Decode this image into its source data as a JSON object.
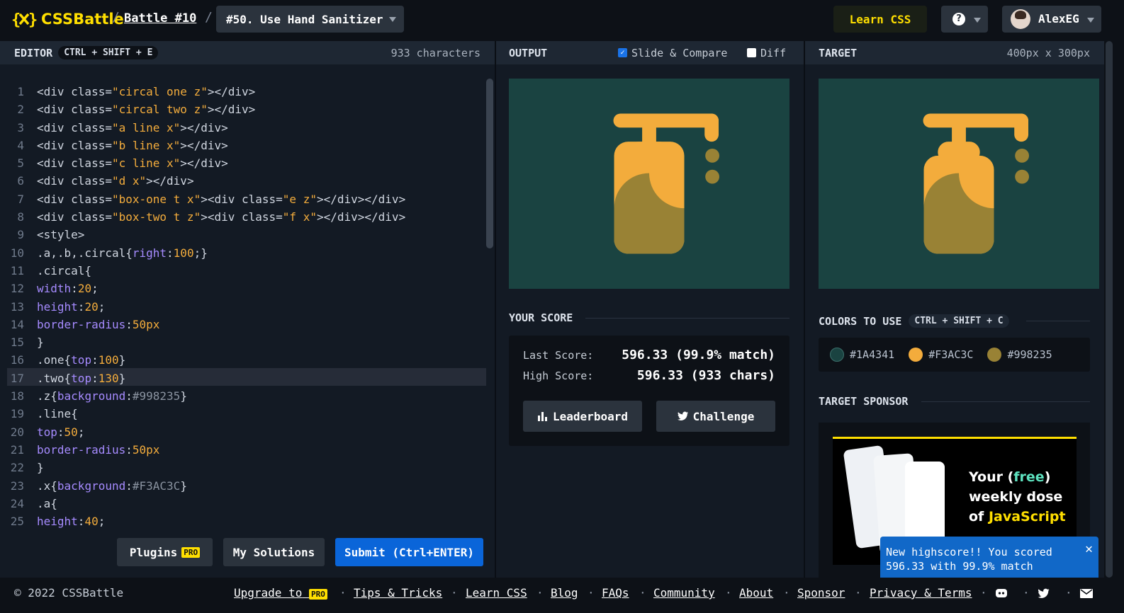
{
  "header": {
    "logo": "CSSBattle",
    "battle": "Battle #10",
    "challenge": "#50. Use Hand Sanitizer",
    "learn": "Learn CSS",
    "user": "AlexEG"
  },
  "editor": {
    "title": "EDITOR",
    "shortcut": "CTRL + SHIFT + E",
    "chars": "933 characters",
    "lines": [
      [
        [
          "t",
          "<div class="
        ],
        [
          "s",
          "\"circal one z\""
        ],
        [
          "t",
          "></div>"
        ]
      ],
      [
        [
          "t",
          "<div class="
        ],
        [
          "s",
          "\"circal two z\""
        ],
        [
          "t",
          "></div>"
        ]
      ],
      [
        [
          "t",
          "<div class="
        ],
        [
          "s",
          "\"a line x\""
        ],
        [
          "t",
          "></div>"
        ]
      ],
      [
        [
          "t",
          "<div class="
        ],
        [
          "s",
          "\"b line x\""
        ],
        [
          "t",
          "></div>"
        ]
      ],
      [
        [
          "t",
          "<div class="
        ],
        [
          "s",
          "\"c line x\""
        ],
        [
          "t",
          "></div>"
        ]
      ],
      [
        [
          "t",
          "<div class="
        ],
        [
          "s",
          "\"d x\""
        ],
        [
          "t",
          "></div>"
        ]
      ],
      [
        [
          "t",
          "<div class="
        ],
        [
          "s",
          "\"box-one t x\""
        ],
        [
          "t",
          "><div class="
        ],
        [
          "s",
          "\"e z\""
        ],
        [
          "t",
          "></div></div>"
        ]
      ],
      [
        [
          "t",
          "<div class="
        ],
        [
          "s",
          "\"box-two t z\""
        ],
        [
          "t",
          "><div class="
        ],
        [
          "s",
          "\"f x\""
        ],
        [
          "t",
          "></div></div>"
        ]
      ],
      [
        [
          "t",
          "<style>"
        ]
      ],
      [
        [
          "t",
          ".a,.b,.circal{"
        ],
        [
          "p",
          "right"
        ],
        [
          "t",
          ":"
        ],
        [
          "n",
          "100"
        ],
        [
          "t",
          ";}"
        ]
      ],
      [
        [
          "t",
          ".circal{"
        ]
      ],
      [
        [
          "p",
          "width"
        ],
        [
          "t",
          ":"
        ],
        [
          "n",
          "20"
        ],
        [
          "t",
          ";"
        ]
      ],
      [
        [
          "p",
          "height"
        ],
        [
          "t",
          ":"
        ],
        [
          "n",
          "20"
        ],
        [
          "t",
          ";"
        ]
      ],
      [
        [
          "p",
          "border-radius"
        ],
        [
          "t",
          ":"
        ],
        [
          "n",
          "50px"
        ]
      ],
      [
        [
          "t",
          "}"
        ]
      ],
      [
        [
          "t",
          ".one{"
        ],
        [
          "p",
          "top"
        ],
        [
          "t",
          ":"
        ],
        [
          "n",
          "100"
        ],
        [
          "t",
          "}"
        ]
      ],
      [
        [
          "t",
          ".two{"
        ],
        [
          "p",
          "top"
        ],
        [
          "t",
          ":"
        ],
        [
          "n",
          "130"
        ],
        [
          "t",
          "}"
        ]
      ],
      [
        [
          "t",
          ".z{"
        ],
        [
          "p",
          "background"
        ],
        [
          "t",
          ":"
        ],
        [
          "c",
          "#998235"
        ],
        [
          "t",
          "}"
        ]
      ],
      [
        [
          "t",
          ".line{"
        ]
      ],
      [
        [
          "p",
          "top"
        ],
        [
          "t",
          ":"
        ],
        [
          "n",
          "50"
        ],
        [
          "t",
          ";"
        ]
      ],
      [
        [
          "p",
          "border-radius"
        ],
        [
          "t",
          ":"
        ],
        [
          "n",
          "50px"
        ]
      ],
      [
        [
          "t",
          "}"
        ]
      ],
      [
        [
          "t",
          ".x{"
        ],
        [
          "p",
          "background"
        ],
        [
          "t",
          ":"
        ],
        [
          "c",
          "#F3AC3C"
        ],
        [
          "t",
          "}"
        ]
      ],
      [
        [
          "t",
          ".a{"
        ]
      ],
      [
        [
          "p",
          "height"
        ],
        [
          "t",
          ":"
        ],
        [
          "n",
          "40"
        ],
        [
          "t",
          ";"
        ]
      ]
    ],
    "line_numbers": [
      "1",
      "2",
      "3",
      "4",
      "5",
      "6",
      "7",
      "8",
      "9",
      "10",
      "11",
      "12",
      "13",
      "14",
      "15",
      "16",
      "17",
      "18",
      "19",
      "20",
      "21",
      "22",
      "23",
      "24",
      "25"
    ],
    "buttons": {
      "plugins": "Plugins",
      "pro": "PRO",
      "solutions": "My Solutions",
      "submit": "Submit (Ctrl+ENTER)"
    }
  },
  "output": {
    "title": "OUTPUT",
    "slide": "Slide & Compare",
    "diff": "Diff"
  },
  "target": {
    "title": "TARGET",
    "size": "400px x 300px"
  },
  "score": {
    "title": "YOUR SCORE",
    "last_label": "Last Score:",
    "last_value": "596.33 (99.9% match)",
    "high_label": "High Score:",
    "high_value": "596.33 (933 chars)",
    "leaderboard": "Leaderboard",
    "challenge": "Challenge"
  },
  "colors": {
    "title": "COLORS TO USE",
    "shortcut": "CTRL + SHIFT + C",
    "list": [
      {
        "hex": "#1A4341"
      },
      {
        "hex": "#F3AC3C"
      },
      {
        "hex": "#998235"
      }
    ]
  },
  "sponsor": {
    "title": "TARGET SPONSOR",
    "line1a": "Your (",
    "free": "free",
    "line1b": ")",
    "line2": "weekly dose",
    "line3a": "of ",
    "js": "JavaScript"
  },
  "toast": {
    "text": "New highscore!! You scored 596.33 with 99.9% match"
  },
  "footer": {
    "copyright": "© 2022 CSSBattle",
    "upgrade": "Upgrade to",
    "pro": "PRO",
    "tips": "Tips & Tricks",
    "learn": "Learn CSS",
    "blog": "Blog",
    "faqs": "FAQs",
    "community": "Community",
    "about": "About",
    "sponsor": "Sponsor",
    "privacy": "Privacy & Terms"
  },
  "palette": {
    "bg": "#1A4341",
    "orange": "#F3AC3C",
    "olive": "#998235",
    "accent": "#ffdf00",
    "blue": "#1168c8"
  }
}
